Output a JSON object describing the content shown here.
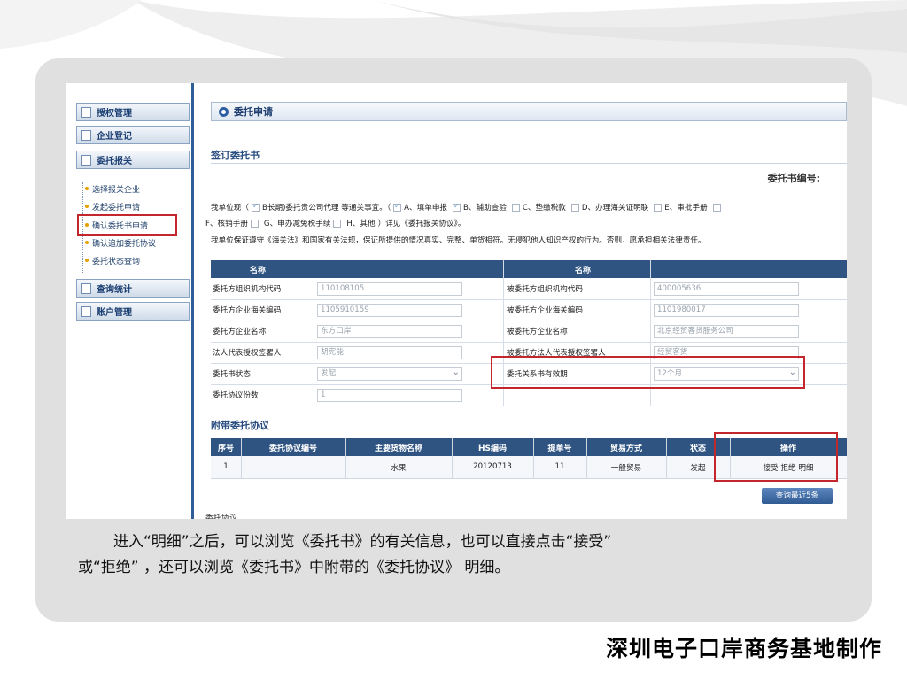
{
  "sidebar": {
    "sections": [
      {
        "label": "授权管理"
      },
      {
        "label": "企业登记"
      },
      {
        "label": "委托报关"
      },
      {
        "label": "查询统计"
      },
      {
        "label": "账户管理"
      }
    ],
    "items": [
      {
        "label": "选择报关企业"
      },
      {
        "label": "发起委托申请"
      },
      {
        "label": "确认委托书申请",
        "selected": true
      },
      {
        "label": "确认追加委托协议"
      },
      {
        "label": "委托状态查询"
      }
    ]
  },
  "page": {
    "title": "委托申请",
    "section1": "签订委托书",
    "cert_no_label": "委托书编号:",
    "para": {
      "p1": "我单位现（",
      "p2": "B长期)委托贵公司代理 等通关事宜。（",
      "opt_a": "A、填单申报",
      "opt_b": "B、辅助查验",
      "opt_c": "C、垫缴税款",
      "opt_d": "D、办理海关证明联",
      "opt_e": "E、审批手册",
      "opt_f": "F、核销手册",
      "opt_g": "G、申办减免税手续",
      "opt_h": "H、其他",
      "p3": "）详见《委托报关协议》。",
      "line3": "我单位保证遵守《海关法》和国家有关法规，保证所提供的情况真实、完整、单货相符。无侵犯他人知识产权的行为。否则，愿承担相关法律责任。"
    },
    "info": {
      "header_left": "名称",
      "header_right": "名称",
      "rows": [
        {
          "l_label": "委托方组织机构代码",
          "l_value": "110108105",
          "r_label": "被委托方组织机构代码",
          "r_value": "400005636"
        },
        {
          "l_label": "委托方企业海关编码",
          "l_value": "1105910159",
          "r_label": "被委托方企业海关编码",
          "r_value": "1101980017"
        },
        {
          "l_label": "委托方企业名称",
          "l_value": "东方口岸",
          "r_label": "被委托方企业名称",
          "r_value": "北京经贸客货服务公司"
        },
        {
          "l_label": "法人代表授权签署人",
          "l_value": "胡宪能",
          "r_label": "被委托方法人代表授权签署人",
          "r_value": "经贸客货"
        },
        {
          "l_label": "委托书状态",
          "l_value": "发起",
          "r_label": "委托关系书有效期",
          "r_value": "12个月"
        },
        {
          "l_label": "委托协议份数",
          "l_value": "1",
          "r_label": "",
          "r_value": ""
        }
      ]
    },
    "section2": "附带委托协议",
    "agreement": {
      "headers": [
        "序号",
        "委托协议编号",
        "主要货物名称",
        "HS编码",
        "提单号",
        "贸易方式",
        "状态",
        "操作"
      ],
      "row": {
        "seq": "1",
        "no": "",
        "goods": "水果",
        "hs": "20120713",
        "bill": "11",
        "trade": "一般贸易",
        "status": "发起"
      },
      "actions": {
        "accept": "接受",
        "reject": "拒绝",
        "detail": "明细"
      }
    },
    "more_button": "查询最近5条",
    "cut_text": "委托协议"
  },
  "caption": {
    "line1": "进入“明细”之后，可以浏览《委托书》的有关信息，也可以直接点击“接受”",
    "line2": "或“拒绝” ，还可以浏览《委托书》中附带的《委托协议》 明细。"
  },
  "footer": "深圳电子口岸商务基地制作",
  "colors": {
    "header_bg": "#2f5482",
    "highlight": "#c4262e",
    "panel": "#e0e0e0"
  }
}
